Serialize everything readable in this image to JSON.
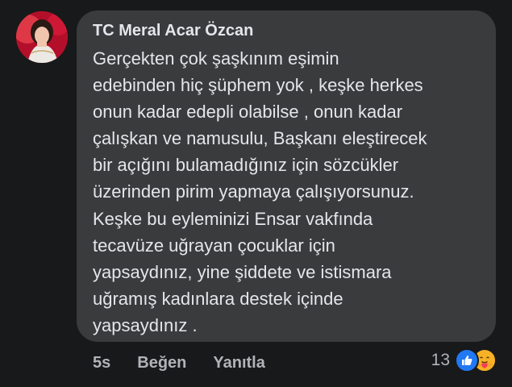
{
  "comment": {
    "author": "TC Meral Acar Özcan",
    "body_lines": [
      "Gerçekten çok şaşkınım eşimin",
      "edebinden hiç şüphem yok , keşke herkes",
      "onun kadar edepli olabilse , onun kadar",
      "çalışkan ve namusulu, Başkanı eleştirecek",
      "bir açığını bulamadığınız için sözcükler",
      "üzerinden pirim yapmaya çalışıyorsunuz.",
      "Keşke bu eyleminizi Ensar vakfında",
      "tecavüze uğrayan çocuklar için",
      "yapsaydınız, yine şiddete ve istismara",
      "uğramış kadınlara destek içinde",
      "yapsaydınız ."
    ]
  },
  "actions": {
    "time": "5s",
    "like_label": "Beğen",
    "reply_label": "Yanıtla"
  },
  "reactions": {
    "count": "13",
    "icons": [
      "like-reaction-icon",
      "care-reaction-icon"
    ]
  },
  "colors": {
    "background": "#18191a",
    "bubble": "#3a3b3c",
    "text_primary": "#e4e6eb",
    "text_secondary": "#b0b3b8",
    "like_blue": "#2078f4",
    "care_yellow": "#f7b125"
  }
}
